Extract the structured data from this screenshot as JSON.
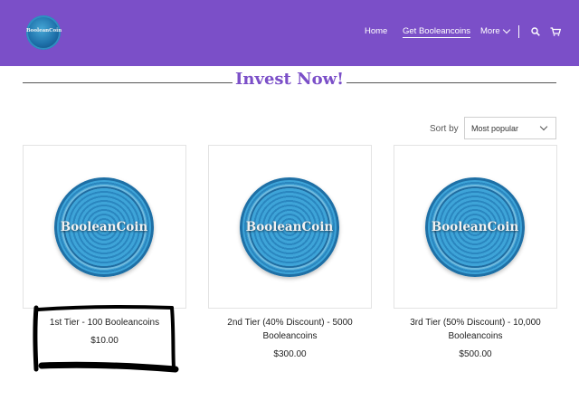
{
  "header": {
    "logo_text": "BooleanCoin",
    "nav": {
      "home": "Home",
      "get": "Get Booleancoins",
      "more": "More"
    },
    "icons": [
      "chevron-down-icon",
      "search-icon",
      "cart-icon"
    ]
  },
  "main": {
    "title": "Invest Now!",
    "sort": {
      "label": "Sort by",
      "value": "Most popular"
    }
  },
  "products": [
    {
      "coin_text": "BooleanCoin",
      "name": "1st Tier - 100 Booleancoins",
      "price": "$10.00"
    },
    {
      "coin_text": "BooleanCoin",
      "name": "2nd Tier (40% Discount) - 5000 Booleancoins",
      "price": "$300.00"
    },
    {
      "coin_text": "BooleanCoin",
      "name": "3rd Tier (50% Discount) - 10,000 Booleancoins",
      "price": "$500.00"
    }
  ],
  "colors": {
    "brand": "#7b4fc8",
    "marker": "#000000"
  }
}
